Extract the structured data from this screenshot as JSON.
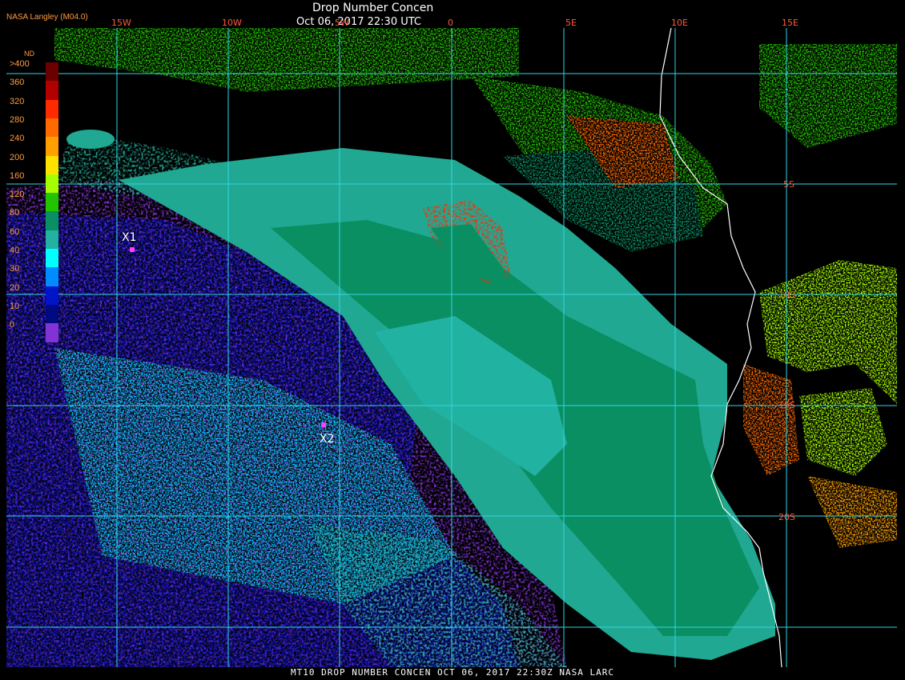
{
  "header": {
    "title": "Drop Number Concen",
    "subtitle": "Oct 06, 2017 22:30 UTC",
    "credit": "NASA Langley (M04.0)"
  },
  "map": {
    "lon_labels": [
      "15W",
      "10W",
      "5W",
      "0",
      "5E",
      "10E",
      "15E"
    ],
    "lat_labels": [
      "5S",
      "10S",
      "15S",
      "20S"
    ]
  },
  "legend": {
    "title": "ND",
    "labels": [
      ">400",
      "360",
      "320",
      "280",
      "240",
      "200",
      "160",
      "120",
      "80",
      "60",
      "40",
      "30",
      "20",
      "10",
      "0"
    ],
    "colors": [
      "#6b0000",
      "#b00000",
      "#ff2a00",
      "#ff6a00",
      "#ff9f00",
      "#ffe100",
      "#a6ff00",
      "#22c400",
      "#0a8f63",
      "#21b2a2",
      "#00ffff",
      "#008cff",
      "#0015c8",
      "#000a82",
      "#8233d6"
    ]
  },
  "markers": [
    {
      "label": "X1"
    },
    {
      "label": "X2"
    }
  ],
  "footer": "MT10  DROP NUMBER CONCEN   OCT 06, 2017 22:30Z   NASA LARC"
}
